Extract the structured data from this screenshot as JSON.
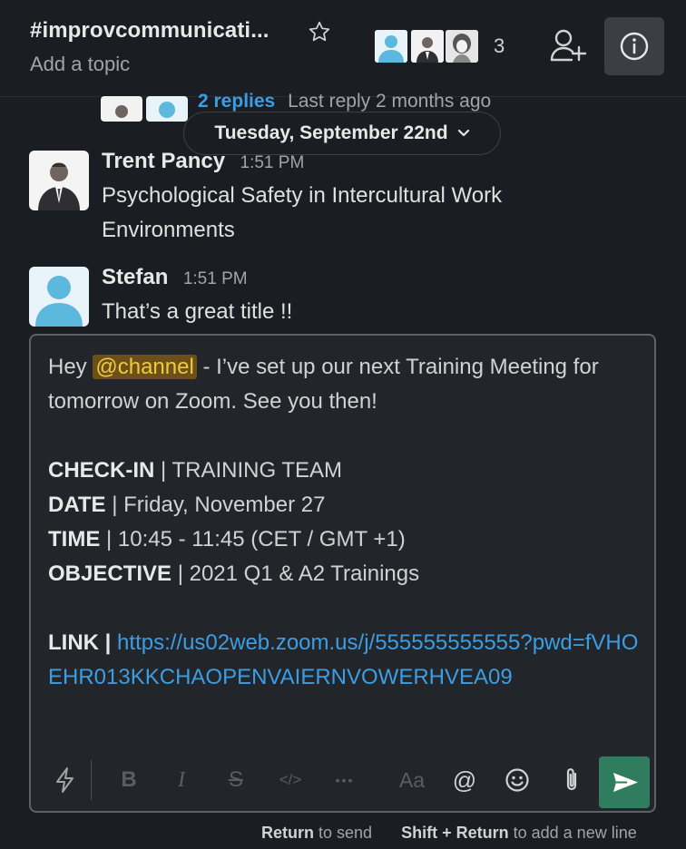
{
  "header": {
    "channel": "#improvcommunicati...",
    "topic": "Add a topic",
    "member_count": "3"
  },
  "thread": {
    "replies": "2 replies",
    "last_reply": "Last reply 2 months ago"
  },
  "divider": {
    "date": "Tuesday, September 22nd"
  },
  "messages": [
    {
      "name": "Trent Pancy",
      "time": "1:51 PM",
      "text": "Psychological Safety in Intercultural Work Environments"
    },
    {
      "name": "Stefan",
      "time": "1:51 PM",
      "text": "That’s a great title !!"
    }
  ],
  "composer": {
    "hey": "Hey",
    "mention": "@channel",
    "line1_rest": " - I’ve set up our next Training Meeting for tomorrow on Zoom. See you then!",
    "checkin_label": "CHECK-IN",
    "checkin_value": " | TRAINING TEAM",
    "date_label": "DATE",
    "date_value": " | Friday, November 27",
    "time_label": "TIME",
    "time_value": " | 10:45 - 11:45 (CET / GMT +1)",
    "objective_label": "OBJECTIVE",
    "objective_value": " | 2021 Q1 & A2 Trainings",
    "link_label": "LINK |",
    "link_url": "https://us02web.zoom.us/j/555555555555?pwd=fVHOEHR013KKCHAOPENVAIERNVOWERHVEA09"
  },
  "toolbar": {
    "bold": "B",
    "italic": "I",
    "strike": "S",
    "code": "</>",
    "more": "•••",
    "format": "Aa",
    "mention": "@"
  },
  "hint": {
    "return": "Return",
    "to_send": "to send",
    "shift_return": "Shift + Return",
    "new_line": "to add a new line"
  },
  "colors": {
    "background": "#1a1d21",
    "link": "#3b9ee5",
    "send": "#2f7c5e",
    "mention_bg": "#6b5117",
    "mention_fg": "#f2c744",
    "avatar_default": "#5cb8dd"
  }
}
